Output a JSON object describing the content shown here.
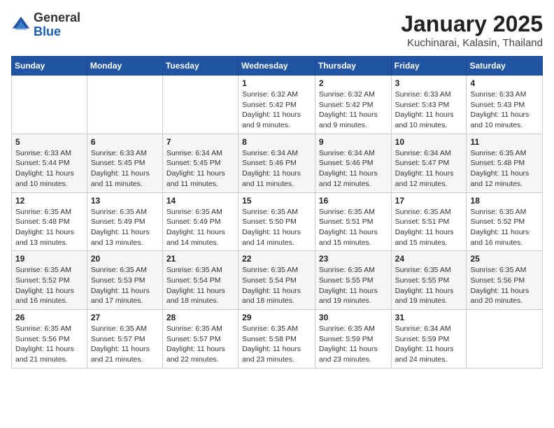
{
  "header": {
    "logo_general": "General",
    "logo_blue": "Blue",
    "month_title": "January 2025",
    "location": "Kuchinarai, Kalasin, Thailand"
  },
  "days_of_week": [
    "Sunday",
    "Monday",
    "Tuesday",
    "Wednesday",
    "Thursday",
    "Friday",
    "Saturday"
  ],
  "weeks": [
    [
      {
        "day": "",
        "sunrise": "",
        "sunset": "",
        "daylight": ""
      },
      {
        "day": "",
        "sunrise": "",
        "sunset": "",
        "daylight": ""
      },
      {
        "day": "",
        "sunrise": "",
        "sunset": "",
        "daylight": ""
      },
      {
        "day": "1",
        "sunrise": "Sunrise: 6:32 AM",
        "sunset": "Sunset: 5:42 PM",
        "daylight": "Daylight: 11 hours and 9 minutes."
      },
      {
        "day": "2",
        "sunrise": "Sunrise: 6:32 AM",
        "sunset": "Sunset: 5:42 PM",
        "daylight": "Daylight: 11 hours and 9 minutes."
      },
      {
        "day": "3",
        "sunrise": "Sunrise: 6:33 AM",
        "sunset": "Sunset: 5:43 PM",
        "daylight": "Daylight: 11 hours and 10 minutes."
      },
      {
        "day": "4",
        "sunrise": "Sunrise: 6:33 AM",
        "sunset": "Sunset: 5:43 PM",
        "daylight": "Daylight: 11 hours and 10 minutes."
      }
    ],
    [
      {
        "day": "5",
        "sunrise": "Sunrise: 6:33 AM",
        "sunset": "Sunset: 5:44 PM",
        "daylight": "Daylight: 11 hours and 10 minutes."
      },
      {
        "day": "6",
        "sunrise": "Sunrise: 6:33 AM",
        "sunset": "Sunset: 5:45 PM",
        "daylight": "Daylight: 11 hours and 11 minutes."
      },
      {
        "day": "7",
        "sunrise": "Sunrise: 6:34 AM",
        "sunset": "Sunset: 5:45 PM",
        "daylight": "Daylight: 11 hours and 11 minutes."
      },
      {
        "day": "8",
        "sunrise": "Sunrise: 6:34 AM",
        "sunset": "Sunset: 5:46 PM",
        "daylight": "Daylight: 11 hours and 11 minutes."
      },
      {
        "day": "9",
        "sunrise": "Sunrise: 6:34 AM",
        "sunset": "Sunset: 5:46 PM",
        "daylight": "Daylight: 11 hours and 12 minutes."
      },
      {
        "day": "10",
        "sunrise": "Sunrise: 6:34 AM",
        "sunset": "Sunset: 5:47 PM",
        "daylight": "Daylight: 11 hours and 12 minutes."
      },
      {
        "day": "11",
        "sunrise": "Sunrise: 6:35 AM",
        "sunset": "Sunset: 5:48 PM",
        "daylight": "Daylight: 11 hours and 12 minutes."
      }
    ],
    [
      {
        "day": "12",
        "sunrise": "Sunrise: 6:35 AM",
        "sunset": "Sunset: 5:48 PM",
        "daylight": "Daylight: 11 hours and 13 minutes."
      },
      {
        "day": "13",
        "sunrise": "Sunrise: 6:35 AM",
        "sunset": "Sunset: 5:49 PM",
        "daylight": "Daylight: 11 hours and 13 minutes."
      },
      {
        "day": "14",
        "sunrise": "Sunrise: 6:35 AM",
        "sunset": "Sunset: 5:49 PM",
        "daylight": "Daylight: 11 hours and 14 minutes."
      },
      {
        "day": "15",
        "sunrise": "Sunrise: 6:35 AM",
        "sunset": "Sunset: 5:50 PM",
        "daylight": "Daylight: 11 hours and 14 minutes."
      },
      {
        "day": "16",
        "sunrise": "Sunrise: 6:35 AM",
        "sunset": "Sunset: 5:51 PM",
        "daylight": "Daylight: 11 hours and 15 minutes."
      },
      {
        "day": "17",
        "sunrise": "Sunrise: 6:35 AM",
        "sunset": "Sunset: 5:51 PM",
        "daylight": "Daylight: 11 hours and 15 minutes."
      },
      {
        "day": "18",
        "sunrise": "Sunrise: 6:35 AM",
        "sunset": "Sunset: 5:52 PM",
        "daylight": "Daylight: 11 hours and 16 minutes."
      }
    ],
    [
      {
        "day": "19",
        "sunrise": "Sunrise: 6:35 AM",
        "sunset": "Sunset: 5:52 PM",
        "daylight": "Daylight: 11 hours and 16 minutes."
      },
      {
        "day": "20",
        "sunrise": "Sunrise: 6:35 AM",
        "sunset": "Sunset: 5:53 PM",
        "daylight": "Daylight: 11 hours and 17 minutes."
      },
      {
        "day": "21",
        "sunrise": "Sunrise: 6:35 AM",
        "sunset": "Sunset: 5:54 PM",
        "daylight": "Daylight: 11 hours and 18 minutes."
      },
      {
        "day": "22",
        "sunrise": "Sunrise: 6:35 AM",
        "sunset": "Sunset: 5:54 PM",
        "daylight": "Daylight: 11 hours and 18 minutes."
      },
      {
        "day": "23",
        "sunrise": "Sunrise: 6:35 AM",
        "sunset": "Sunset: 5:55 PM",
        "daylight": "Daylight: 11 hours and 19 minutes."
      },
      {
        "day": "24",
        "sunrise": "Sunrise: 6:35 AM",
        "sunset": "Sunset: 5:55 PM",
        "daylight": "Daylight: 11 hours and 19 minutes."
      },
      {
        "day": "25",
        "sunrise": "Sunrise: 6:35 AM",
        "sunset": "Sunset: 5:56 PM",
        "daylight": "Daylight: 11 hours and 20 minutes."
      }
    ],
    [
      {
        "day": "26",
        "sunrise": "Sunrise: 6:35 AM",
        "sunset": "Sunset: 5:56 PM",
        "daylight": "Daylight: 11 hours and 21 minutes."
      },
      {
        "day": "27",
        "sunrise": "Sunrise: 6:35 AM",
        "sunset": "Sunset: 5:57 PM",
        "daylight": "Daylight: 11 hours and 21 minutes."
      },
      {
        "day": "28",
        "sunrise": "Sunrise: 6:35 AM",
        "sunset": "Sunset: 5:57 PM",
        "daylight": "Daylight: 11 hours and 22 minutes."
      },
      {
        "day": "29",
        "sunrise": "Sunrise: 6:35 AM",
        "sunset": "Sunset: 5:58 PM",
        "daylight": "Daylight: 11 hours and 23 minutes."
      },
      {
        "day": "30",
        "sunrise": "Sunrise: 6:35 AM",
        "sunset": "Sunset: 5:59 PM",
        "daylight": "Daylight: 11 hours and 23 minutes."
      },
      {
        "day": "31",
        "sunrise": "Sunrise: 6:34 AM",
        "sunset": "Sunset: 5:59 PM",
        "daylight": "Daylight: 11 hours and 24 minutes."
      },
      {
        "day": "",
        "sunrise": "",
        "sunset": "",
        "daylight": ""
      }
    ]
  ]
}
